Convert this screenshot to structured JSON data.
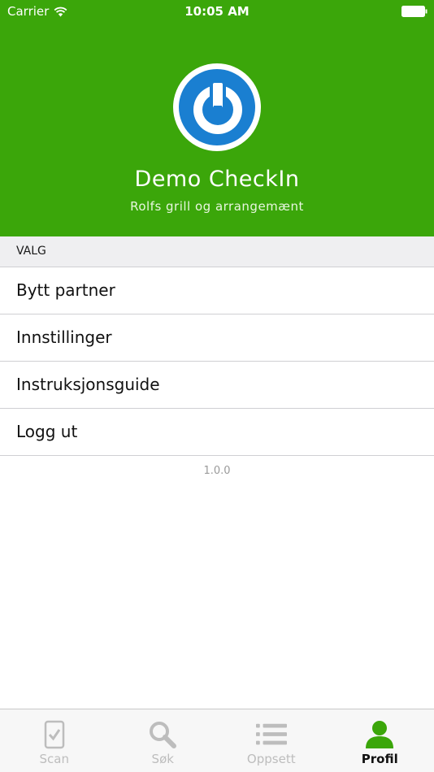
{
  "status_bar": {
    "carrier": "Carrier",
    "time": "10:05 AM"
  },
  "header": {
    "title": "Demo CheckIn",
    "subtitle": "Rolfs grill og arrangemænt"
  },
  "section": {
    "label": "VALG"
  },
  "menu": {
    "items": [
      {
        "label": "Bytt partner"
      },
      {
        "label": "Innstillinger"
      },
      {
        "label": "Instruksjonsguide"
      },
      {
        "label": "Logg ut"
      }
    ]
  },
  "version": "1.0.0",
  "tabs": [
    {
      "label": "Scan",
      "icon": "phone-check-icon",
      "active": false
    },
    {
      "label": "Søk",
      "icon": "search-icon",
      "active": false
    },
    {
      "label": "Oppsett",
      "icon": "list-icon",
      "active": false
    },
    {
      "label": "Profil",
      "icon": "person-icon",
      "active": true
    }
  ],
  "colors": {
    "brand_green": "#3ba60a",
    "logo_blue": "#1a7fd1",
    "inactive_tab": "#bdbdbd"
  }
}
